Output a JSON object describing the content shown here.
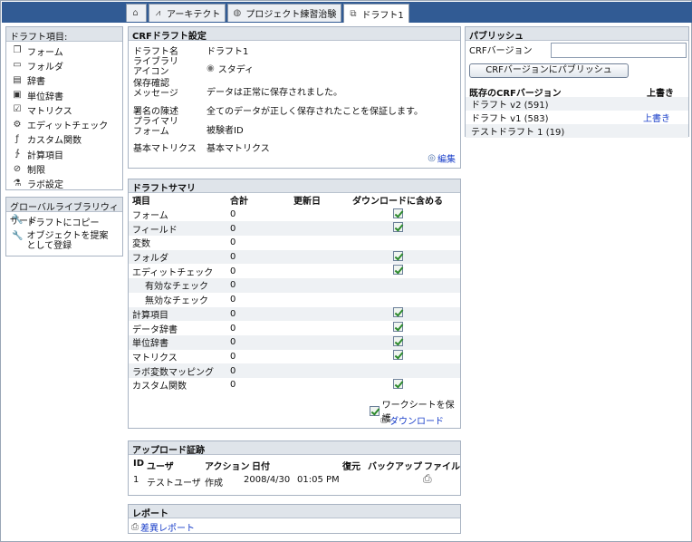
{
  "tabs": [
    {
      "label": "",
      "icon": "home-icon"
    },
    {
      "label": "アーキテクト",
      "icon": "architect-icon"
    },
    {
      "label": "プロジェクト練習治験",
      "icon": "project-icon"
    },
    {
      "label": "ドラフト1",
      "icon": "draft-icon"
    }
  ],
  "left": {
    "draft_items_title": "ドラフト項目:",
    "items": [
      {
        "label": "フォーム",
        "icon": "form-icon"
      },
      {
        "label": "フォルダ",
        "icon": "folder-icon"
      },
      {
        "label": "辞書",
        "icon": "dictionary-icon"
      },
      {
        "label": "単位辞書",
        "icon": "unit-dictionary-icon"
      },
      {
        "label": "マトリクス",
        "icon": "matrix-icon"
      },
      {
        "label": "エディットチェック",
        "icon": "edit-check-icon"
      },
      {
        "label": "カスタム関数",
        "icon": "custom-function-icon"
      },
      {
        "label": "計算項目",
        "icon": "derivation-icon"
      },
      {
        "label": "制限",
        "icon": "restriction-icon"
      },
      {
        "label": "ラボ設定",
        "icon": "lab-settings-icon"
      }
    ],
    "wizard_title": "グローバルライブラリウィザード",
    "wizard_items": [
      {
        "label": "ドラフトにコピー"
      },
      {
        "label": "オブジェクトを提案\nとして登録"
      }
    ]
  },
  "crf": {
    "title": "CRFドラフト設定",
    "rows": [
      {
        "key": "ドラフト名",
        "value": "ドラフト1"
      },
      {
        "key": "ライブラリ\nアイコン",
        "value": "スタディ"
      },
      {
        "key": "保存確認\nメッセージ",
        "value": "データは正常に保存されました。"
      },
      {
        "key": "署名の陳述",
        "value": "全てのデータが正しく保存されたことを保証します。"
      },
      {
        "key": "プライマリ\nフォーム",
        "value": "被験者ID"
      },
      {
        "key": "基本マトリクス",
        "value": "基本マトリクス"
      }
    ],
    "edit_label": "編集"
  },
  "summary": {
    "title": "ドラフトサマリ",
    "headers": [
      "項目",
      "合計",
      "更新日",
      "ダウンロードに含める"
    ],
    "rows": [
      {
        "label": "フォーム",
        "total": "0",
        "checked": true,
        "indent": false
      },
      {
        "label": "フィールド",
        "total": "0",
        "checked": true,
        "indent": false
      },
      {
        "label": "変数",
        "total": "0",
        "checked": false,
        "indent": false
      },
      {
        "label": "フォルダ",
        "total": "0",
        "checked": true,
        "indent": false
      },
      {
        "label": "エディットチェック",
        "total": "0",
        "checked": true,
        "indent": false
      },
      {
        "label": "有効なチェック",
        "total": "0",
        "checked": false,
        "indent": true
      },
      {
        "label": "無効なチェック",
        "total": "0",
        "checked": false,
        "indent": true
      },
      {
        "label": "計算項目",
        "total": "0",
        "checked": true,
        "indent": false
      },
      {
        "label": "データ辞書",
        "total": "0",
        "checked": true,
        "indent": false
      },
      {
        "label": "単位辞書",
        "total": "0",
        "checked": true,
        "indent": false
      },
      {
        "label": "マトリクス",
        "total": "0",
        "checked": true,
        "indent": false
      },
      {
        "label": "ラボ変数マッピング",
        "total": "0",
        "checked": false,
        "indent": false
      },
      {
        "label": "カスタム関数",
        "total": "0",
        "checked": true,
        "indent": false
      }
    ],
    "protect_label": "ワークシートを保護",
    "download_label": "ダウンロード"
  },
  "upload": {
    "title": "アップロード証跡",
    "headers": [
      "ID",
      "ユーザ",
      "アクション",
      "日付",
      "",
      "復元",
      "バックアップ",
      "ファイル"
    ],
    "row": {
      "id": "1",
      "user": "テストユーザ",
      "action": "作成",
      "date": "2008/4/30",
      "time": "01:05 PM"
    }
  },
  "report": {
    "title": "レポート",
    "link_label": "差異レポート"
  },
  "publish": {
    "title": "パブリッシュ",
    "version_label": "CRFバージョン",
    "version_value": "",
    "button_label": "CRFバージョンにパブリッシュ",
    "existing_header": "既存のCRFバージョン",
    "overwrite_header": "上書き",
    "versions": [
      {
        "name": "ドラフト v2 (591)",
        "overwrite": ""
      },
      {
        "name": "ドラフト v1 (583)",
        "overwrite": "上書き"
      },
      {
        "name": "テストドラフト 1 (19)",
        "overwrite": ""
      }
    ]
  }
}
